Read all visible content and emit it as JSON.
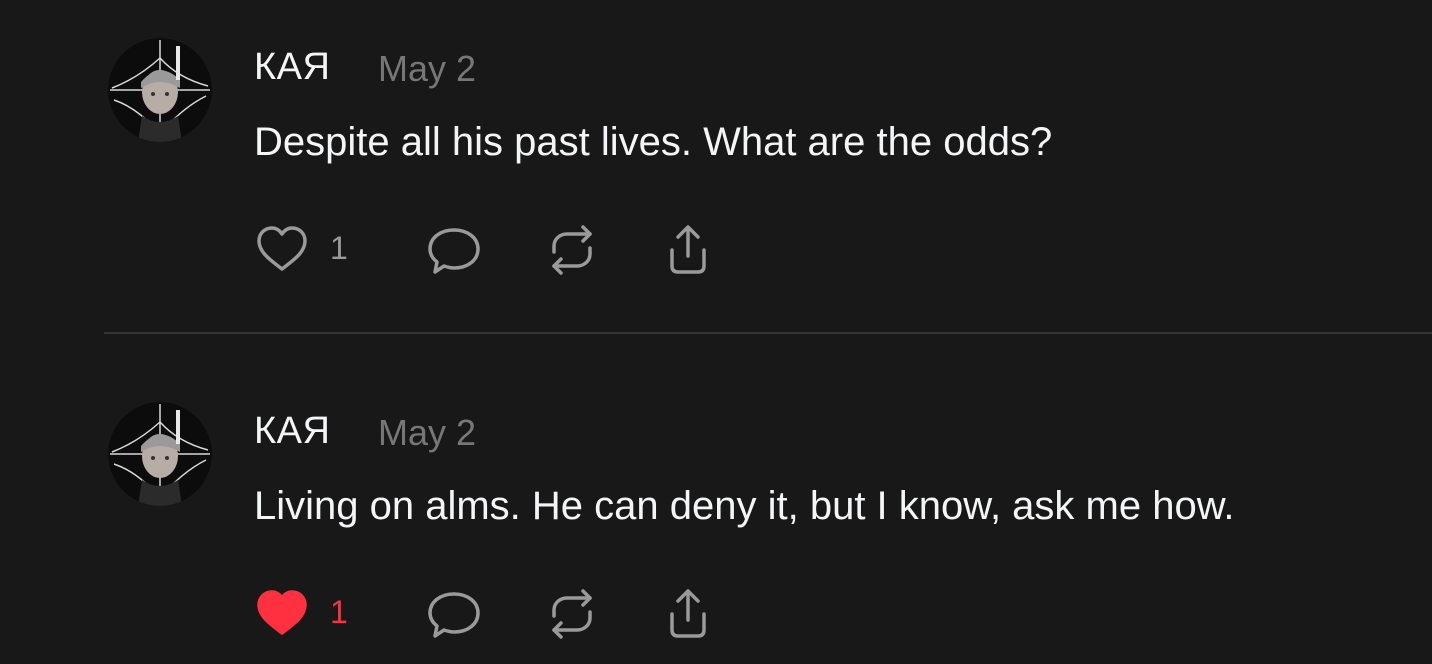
{
  "colors": {
    "background": "#181818",
    "primary_text": "#f3f5f7",
    "secondary_text": "#777777",
    "icon": "#9a9a9a",
    "like_active": "#ff3040",
    "divider": "#333333"
  },
  "posts": [
    {
      "author": "КАЯ",
      "date": "May 2",
      "text": "Despite all his past lives. What are the odds?",
      "like_count": "1",
      "liked": false,
      "icons": [
        "heart-outline-icon",
        "comment-bubble-icon",
        "repost-icon",
        "share-icon"
      ]
    },
    {
      "author": "КАЯ",
      "date": "May 2",
      "text": "Living on alms. He can deny it, but I know, ask me how.",
      "like_count": "1",
      "liked": true,
      "icons": [
        "heart-filled-icon",
        "comment-bubble-icon",
        "repost-icon",
        "share-icon"
      ]
    }
  ]
}
